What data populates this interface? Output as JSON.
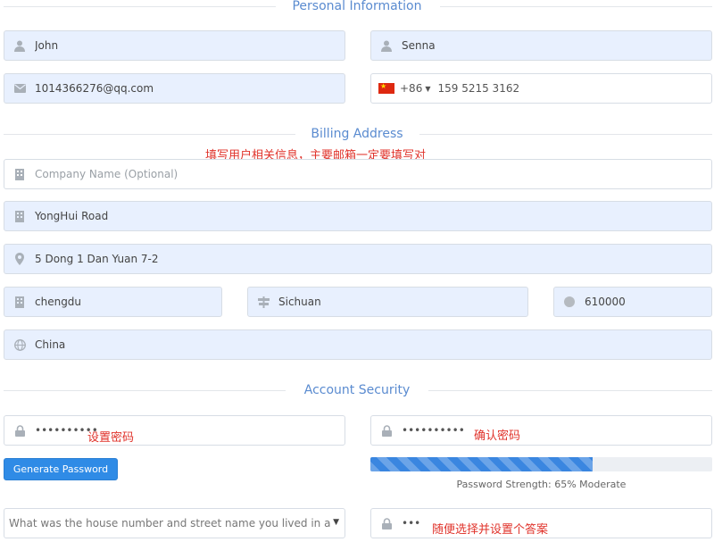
{
  "sections": {
    "personal": "Personal Information",
    "billing": "Billing Address",
    "security": "Account Security"
  },
  "personal": {
    "first_name": "John",
    "last_name": "Senna",
    "email": "1014366276@qq.com",
    "country_code": "+86",
    "phone": "159 5215 3162"
  },
  "billing": {
    "annotation": "填写用户相关信息，主要邮箱一定要填写对",
    "company_placeholder": "Company Name (Optional)",
    "address1": "YongHui Road",
    "address2": "5 Dong 1 Dan Yuan 7-2",
    "city": "chengdu",
    "state": "Sichuan",
    "postcode": "610000",
    "country": "China"
  },
  "security": {
    "password": "••••••••••",
    "password_confirm": "••••••••••",
    "annotation_password": "设置密码",
    "annotation_confirm": "确认密码",
    "generate_label": "Generate Password",
    "strength_label": "Password Strength: 65% Moderate",
    "strength_percent": 65,
    "question": "What was the house number and street name you lived in a",
    "answer": "•••",
    "annotation_answer": "随便选择并设置个答案"
  },
  "colors": {
    "accent": "#2f8be6",
    "section_title": "#5a8bd0",
    "annotation": "#e0332b",
    "field_fill": "#e8f0fe"
  }
}
